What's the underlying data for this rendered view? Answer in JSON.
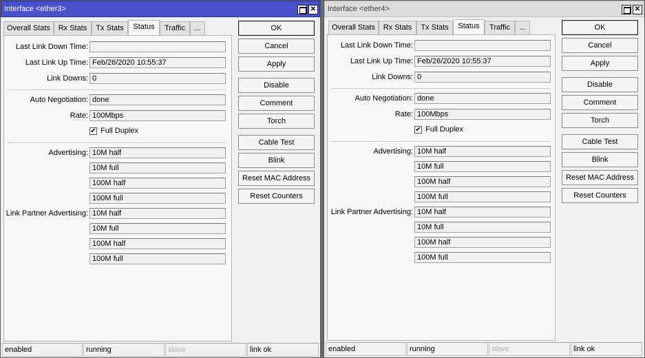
{
  "tab_labels": [
    "Overall Stats",
    "Rx Stats",
    "Tx Stats",
    "Status",
    "Traffic",
    "..."
  ],
  "field_labels": {
    "last_link_down": "Last Link Down Time:",
    "last_link_up": "Last Link Up Time:",
    "link_downs": "Link Downs:",
    "auto_negotiation": "Auto Negotiation:",
    "rate": "Rate:",
    "full_duplex": "Full Duplex",
    "advertising": "Advertising:",
    "link_partner_advertising": "Link Partner Advertising:"
  },
  "button_labels": [
    "OK",
    "Cancel",
    "Apply",
    "Disable",
    "Comment",
    "Torch",
    "Cable Test",
    "Blink",
    "Reset MAC Address",
    "Reset Counters"
  ],
  "windows": [
    {
      "title": "Interface <ether3>",
      "active_tab": "Status",
      "last_link_down_time": "",
      "last_link_up_time": "Feb/26/2020 10:55:37",
      "link_downs": "0",
      "auto_negotiation": "done",
      "rate": "100Mbps",
      "full_duplex": "✔",
      "advertising": [
        "10M half",
        "10M full",
        "100M half",
        "100M full"
      ],
      "link_partner_advertising": [
        "10M half",
        "10M full",
        "100M half",
        "100M full"
      ],
      "status_bar": [
        "enabled",
        "running",
        "slave",
        "link ok"
      ]
    },
    {
      "title": "Interface <ether4>",
      "active_tab": "Status",
      "last_link_down_time": "",
      "last_link_up_time": "Feb/26/2020 10:55:37",
      "link_downs": "0",
      "auto_negotiation": "done",
      "rate": "100Mbps",
      "full_duplex": "✔",
      "advertising": [
        "10M half",
        "10M full",
        "100M half",
        "100M full"
      ],
      "link_partner_advertising": [
        "10M half",
        "10M full",
        "100M half",
        "100M full"
      ],
      "status_bar": [
        "enabled",
        "running",
        "slave",
        "link ok"
      ]
    }
  ],
  "titlebar_buttons": {
    "maximize": "maximize-icon",
    "close": "✕"
  },
  "colors": {
    "active_titlebar": "#4a52d0",
    "inactive_titlebar": "#dcdcdc"
  }
}
